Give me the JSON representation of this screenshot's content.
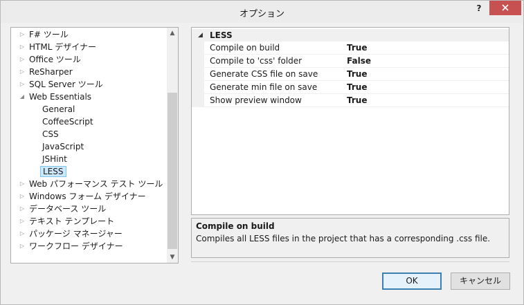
{
  "window": {
    "title": "オプション",
    "help_label": "?"
  },
  "tree": {
    "items": [
      {
        "label": "F# ツール",
        "expanded": false
      },
      {
        "label": "HTML デザイナー",
        "expanded": false
      },
      {
        "label": "Office ツール",
        "expanded": false
      },
      {
        "label": "ReSharper",
        "expanded": false
      },
      {
        "label": "SQL Server ツール",
        "expanded": false
      },
      {
        "label": "Web Essentials",
        "expanded": true
      },
      {
        "label": "General"
      },
      {
        "label": "CoffeeScript"
      },
      {
        "label": "CSS"
      },
      {
        "label": "JavaScript"
      },
      {
        "label": "JSHint"
      },
      {
        "label": "LESS",
        "selected": true
      },
      {
        "label": "Web パフォーマンス テスト ツール",
        "expanded": false
      },
      {
        "label": "Windows フォーム デザイナー",
        "expanded": false
      },
      {
        "label": "データベース ツール",
        "expanded": false
      },
      {
        "label": "テキスト テンプレート",
        "expanded": false
      },
      {
        "label": "パッケージ マネージャー",
        "expanded": false
      },
      {
        "label": "ワークフロー デザイナー",
        "expanded": false
      }
    ]
  },
  "grid": {
    "category": "LESS",
    "properties": [
      {
        "name": "Compile on build",
        "value": "True"
      },
      {
        "name": "Compile to 'css' folder",
        "value": "False"
      },
      {
        "name": "Generate CSS file on save",
        "value": "True"
      },
      {
        "name": "Generate min file on save",
        "value": "True"
      },
      {
        "name": "Show preview window",
        "value": "True"
      }
    ]
  },
  "description": {
    "title": "Compile on build",
    "text": "Compiles all LESS files in the project that has a corresponding .css file."
  },
  "buttons": {
    "ok": "OK",
    "cancel": "キャンセル"
  },
  "colors": {
    "close_button": "#c75050",
    "selection_fill": "#cce8ff",
    "selection_border": "#7fc4f0"
  }
}
